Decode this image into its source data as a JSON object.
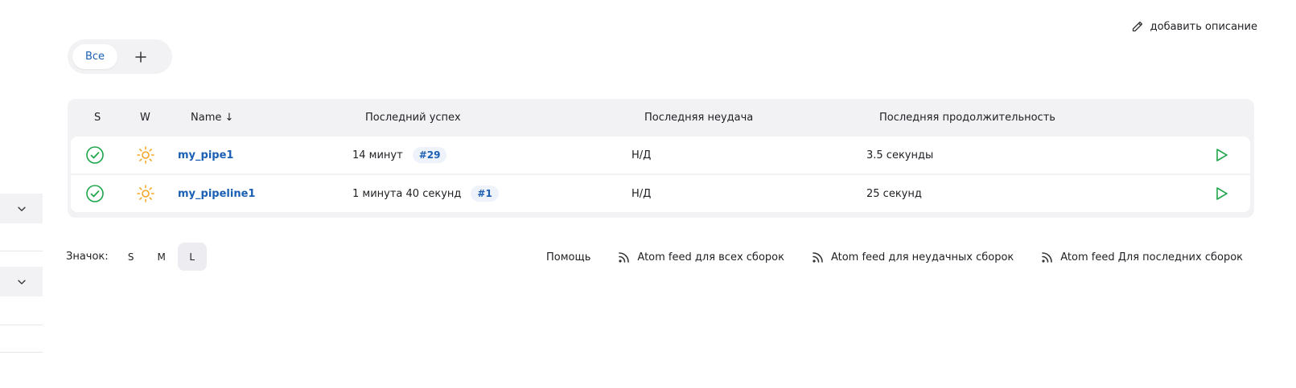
{
  "header": {
    "add_description_label": "добавить описание"
  },
  "view_tabs": {
    "items": [
      {
        "label": "Все",
        "active": true
      }
    ],
    "add_tab_icon": "plus-icon"
  },
  "table": {
    "columns": {
      "status": "S",
      "weather": "W",
      "name": "Name ↓",
      "last_success": "Последний успех",
      "last_failure": "Последняя неудача",
      "last_duration": "Последняя продолжительность"
    },
    "rows": [
      {
        "status_icon": "success-check-icon",
        "weather_icon": "sunny-icon",
        "name": "my_pipe1",
        "last_success_time": "14 минут",
        "last_success_build": "#29",
        "last_failure": "Н/Д",
        "last_duration": "3.5 секунды",
        "action_icon": "play-icon"
      },
      {
        "status_icon": "success-check-icon",
        "weather_icon": "sunny-icon",
        "name": "my_pipeline1",
        "last_success_time": "1 минута 40 секунд",
        "last_success_build": "#1",
        "last_failure": "Н/Д",
        "last_duration": "25 секунд",
        "action_icon": "play-icon"
      }
    ]
  },
  "footer": {
    "icon_size_label": "Значок:",
    "icon_sizes": [
      "S",
      "M",
      "L"
    ],
    "selected_icon_size": "L",
    "help_label": "Помощь",
    "feeds": [
      "Atom feed для всех сборок",
      "Atom feed для неудачных сборок",
      "Atom feed Для последних сборок"
    ]
  },
  "colors": {
    "accent": "#1a5fb4",
    "success": "#1ea64a",
    "weather_sunny": "#f5a623",
    "panel_bg": "#f2f2f5"
  }
}
